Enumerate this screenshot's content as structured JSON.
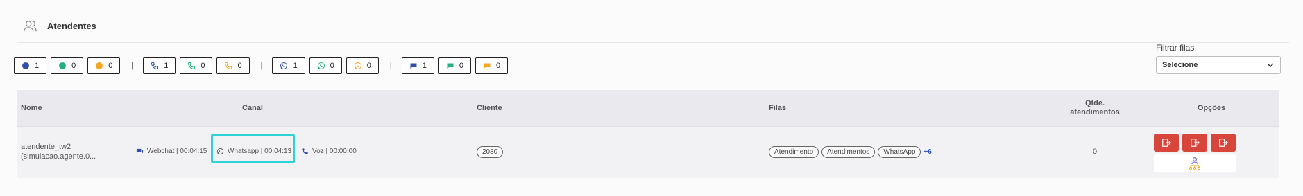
{
  "section": {
    "title": "Atendentes"
  },
  "status_groups": [
    {
      "items": [
        {
          "icon": "circle-blue-icon",
          "count": "1"
        },
        {
          "icon": "circle-green-icon",
          "count": "0"
        },
        {
          "icon": "circle-orange-icon",
          "count": "0"
        }
      ]
    },
    {
      "items": [
        {
          "icon": "phone-blue-icon",
          "count": "1"
        },
        {
          "icon": "phone-green-icon",
          "count": "0"
        },
        {
          "icon": "phone-orange-icon",
          "count": "0"
        }
      ]
    },
    {
      "items": [
        {
          "icon": "whatsapp-blue-icon",
          "count": "1"
        },
        {
          "icon": "whatsapp-green-icon",
          "count": "0"
        },
        {
          "icon": "whatsapp-orange-icon",
          "count": "0"
        }
      ]
    },
    {
      "items": [
        {
          "icon": "chat-blue-icon",
          "count": "1"
        },
        {
          "icon": "chat-green-icon",
          "count": "0"
        },
        {
          "icon": "chat-orange-icon",
          "count": "0"
        }
      ]
    }
  ],
  "separators": [
    "|",
    "|",
    "|"
  ],
  "filter": {
    "label": "Filtrar filas",
    "selected": "Selecione"
  },
  "table": {
    "headers": {
      "nome": "Nome",
      "canal": "Canal",
      "cliente": "Cliente",
      "filas": "Filas",
      "qtde": "Qtde.\natendimentos",
      "opcoes": "Opções"
    },
    "rows": [
      {
        "nome_line1": "atendente_tw2",
        "nome_line2": "(simulacao.agente.0...",
        "channels": {
          "webchat": "Webchat | 00:04:15",
          "whatsapp": "Whatsapp | 00:04:13",
          "voz": "Voz | 00:00:00"
        },
        "cliente": "2080",
        "filas": [
          "Atendimento",
          "Atendimentos",
          "WhatsApp"
        ],
        "filas_more": "+6",
        "qtde": "0"
      }
    ]
  },
  "colors": {
    "blue": "#2f4fa8",
    "green": "#25b07d",
    "orange": "#f5a623",
    "red": "#d8463b",
    "highlight": "#2ed3d6"
  }
}
